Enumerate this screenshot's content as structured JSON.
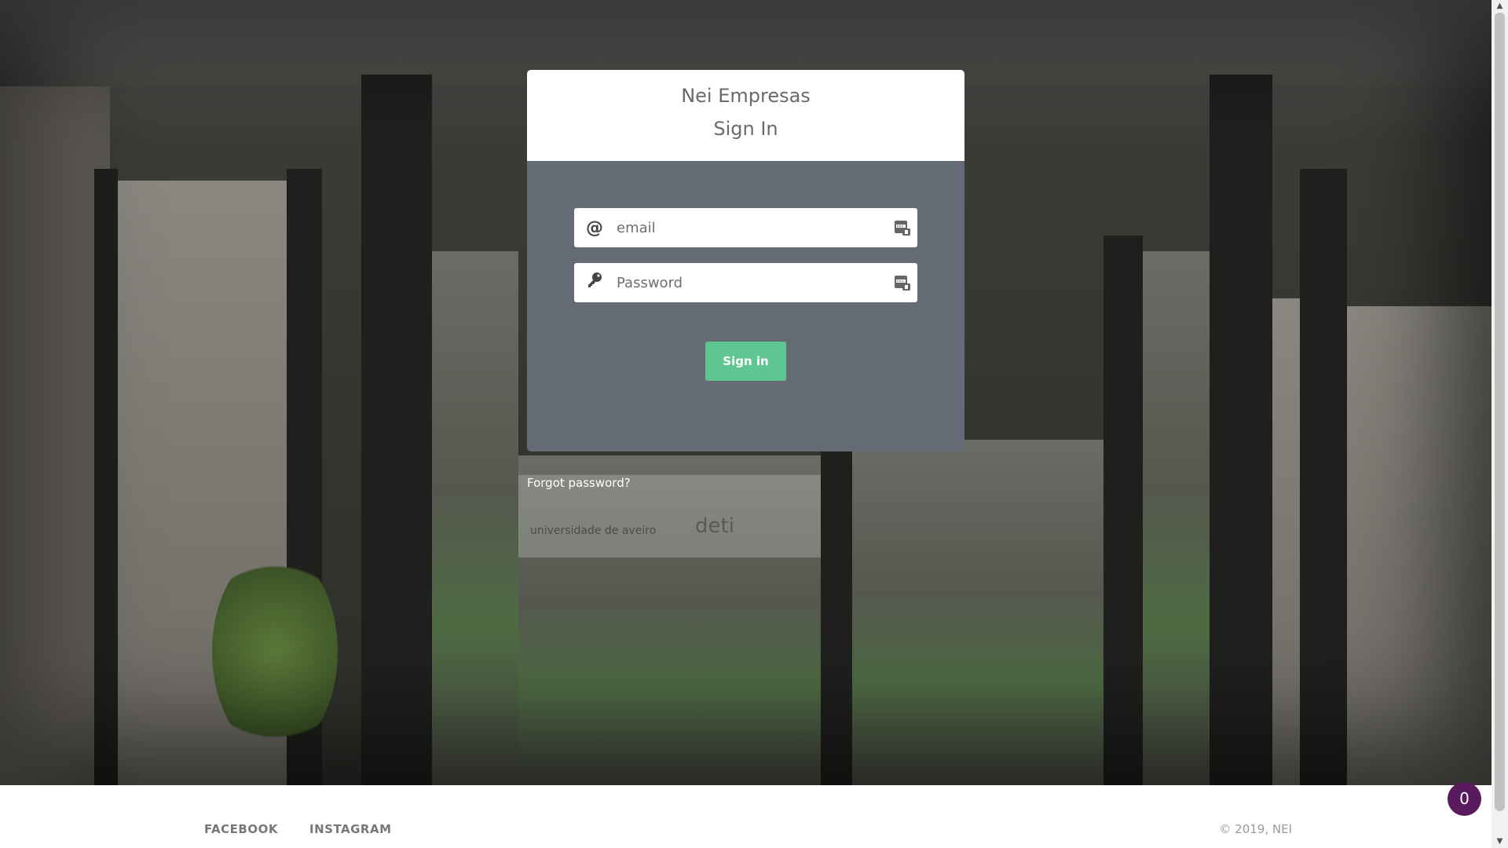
{
  "login": {
    "app_title": "Nei Empresas",
    "form_title": "Sign In",
    "email_placeholder": "email",
    "password_placeholder": "Password",
    "signin_label": "Sign in",
    "forgot_label": "Forgot password?"
  },
  "icons": {
    "email": "at-icon",
    "password": "key-icon",
    "autofill": "password-manager-icon"
  },
  "background": {
    "sign_text": "universidade de aveiro",
    "sign_deti": "deti",
    "right_deti": "deti"
  },
  "footer": {
    "links": [
      "FACEBOOK",
      "INSTAGRAM"
    ],
    "copyright": "© 2019, NEI"
  },
  "notification": {
    "count": "0"
  },
  "colors": {
    "button": "#5fc692",
    "card_body": "#646b74",
    "badge": "#5a1a5e"
  }
}
